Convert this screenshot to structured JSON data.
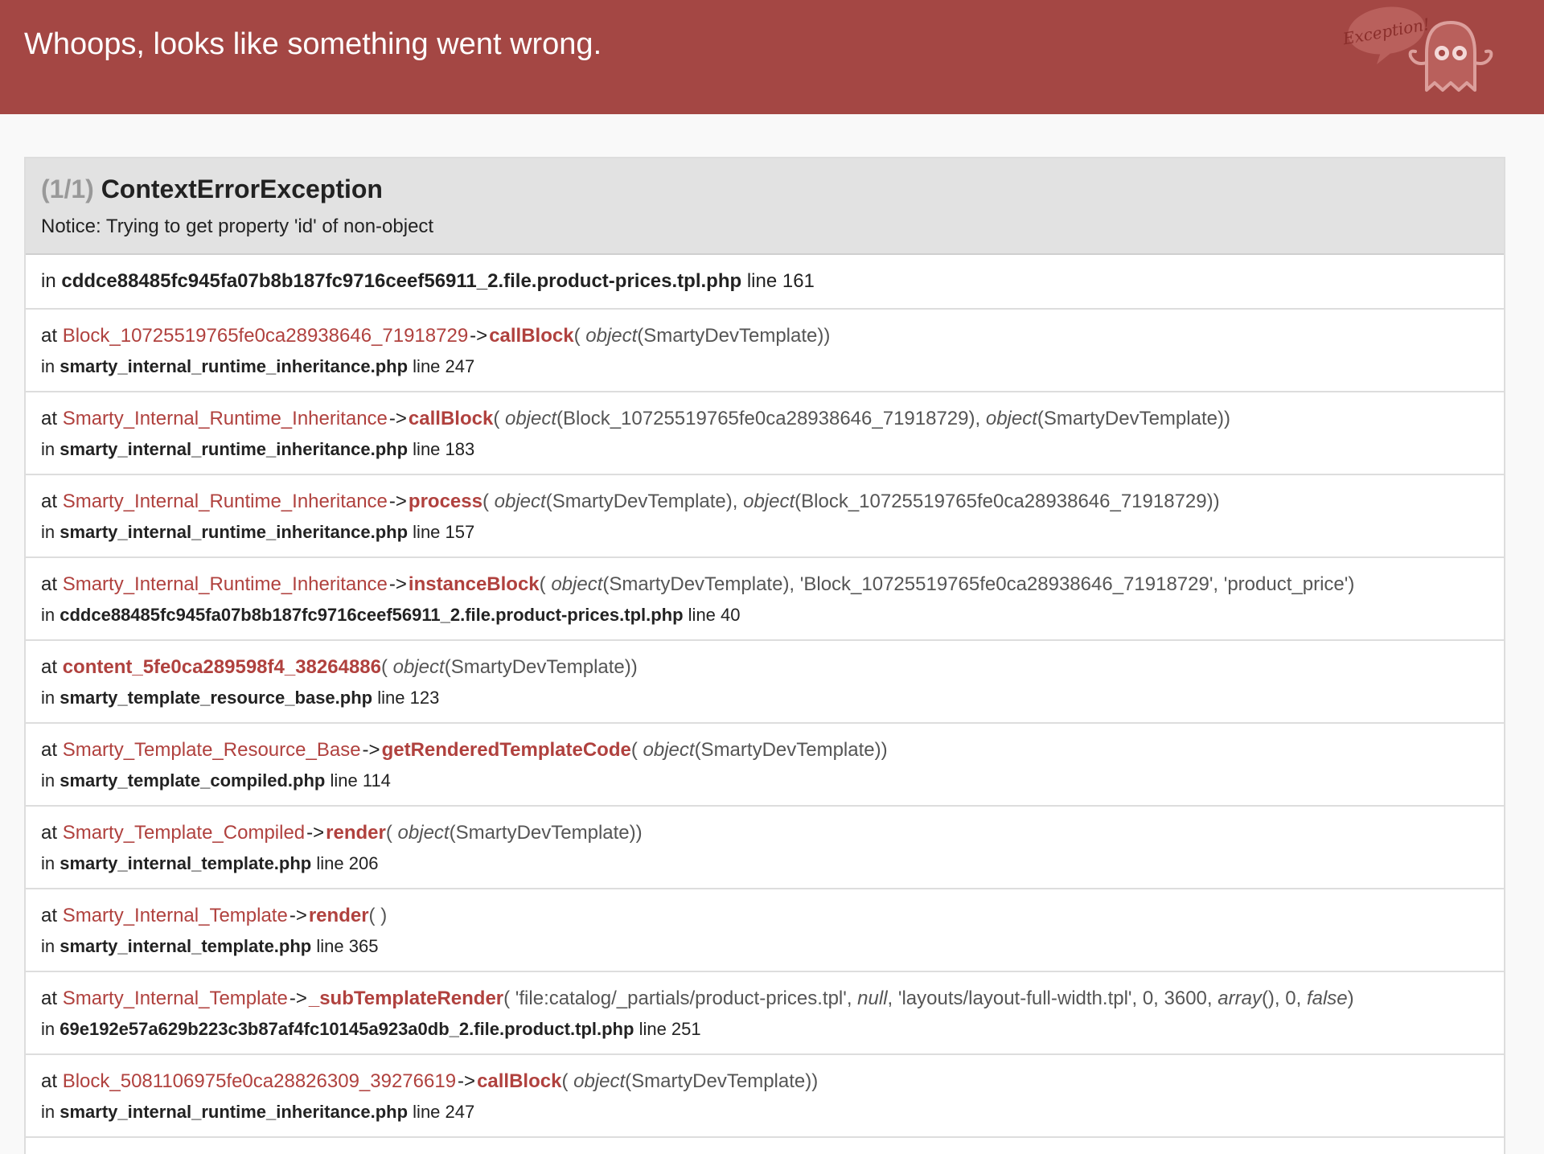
{
  "header": {
    "title": "Whoops, looks like something went wrong.",
    "logo_text": "Exception!",
    "bg_color": "#a44744"
  },
  "exception": {
    "count": "(1/1)",
    "class": "ContextErrorException",
    "message": "Notice: Trying to get property 'id' of non-object"
  },
  "origin": {
    "prefix": "in",
    "file": "cddce88485fc945fa07b8b187fc9716ceef56911_2.file.product-prices.tpl.php",
    "line_text": "line 161"
  },
  "frames": [
    {
      "at": "at",
      "class": "Block_10725519765fe0ca28938646_71918729",
      "arrow": "->",
      "func": "callBlock",
      "args": [
        {
          "t": "text",
          "v": "( "
        },
        {
          "t": "kw",
          "v": "object"
        },
        {
          "t": "text",
          "v": "(SmartyDevTemplate))"
        }
      ],
      "in": "in",
      "file": "smarty_internal_runtime_inheritance.php",
      "line_text": "line 247"
    },
    {
      "at": "at",
      "class": "Smarty_Internal_Runtime_Inheritance",
      "arrow": "->",
      "func": "callBlock",
      "args": [
        {
          "t": "text",
          "v": "( "
        },
        {
          "t": "kw",
          "v": "object"
        },
        {
          "t": "text",
          "v": "(Block_10725519765fe0ca28938646_71918729), "
        },
        {
          "t": "kw",
          "v": "object"
        },
        {
          "t": "text",
          "v": "(SmartyDevTemplate))"
        }
      ],
      "in": "in",
      "file": "smarty_internal_runtime_inheritance.php",
      "line_text": "line 183"
    },
    {
      "at": "at",
      "class": "Smarty_Internal_Runtime_Inheritance",
      "arrow": "->",
      "func": "process",
      "args": [
        {
          "t": "text",
          "v": "( "
        },
        {
          "t": "kw",
          "v": "object"
        },
        {
          "t": "text",
          "v": "(SmartyDevTemplate), "
        },
        {
          "t": "kw",
          "v": "object"
        },
        {
          "t": "text",
          "v": "(Block_10725519765fe0ca28938646_71918729))"
        }
      ],
      "in": "in",
      "file": "smarty_internal_runtime_inheritance.php",
      "line_text": "line 157"
    },
    {
      "at": "at",
      "class": "Smarty_Internal_Runtime_Inheritance",
      "arrow": "->",
      "func": "instanceBlock",
      "args": [
        {
          "t": "text",
          "v": "( "
        },
        {
          "t": "kw",
          "v": "object"
        },
        {
          "t": "text",
          "v": "(SmartyDevTemplate), 'Block_10725519765fe0ca28938646_71918729', 'product_price')"
        }
      ],
      "in": "in",
      "file": "cddce88485fc945fa07b8b187fc9716ceef56911_2.file.product-prices.tpl.php",
      "line_text": "line 40"
    },
    {
      "at": "at",
      "class": "",
      "arrow": "",
      "func": "content_5fe0ca289598f4_38264886",
      "args": [
        {
          "t": "text",
          "v": "( "
        },
        {
          "t": "kw",
          "v": "object"
        },
        {
          "t": "text",
          "v": "(SmartyDevTemplate))"
        }
      ],
      "in": "in",
      "file": "smarty_template_resource_base.php",
      "line_text": "line 123"
    },
    {
      "at": "at",
      "class": "Smarty_Template_Resource_Base",
      "arrow": "->",
      "func": "getRenderedTemplateCode",
      "args": [
        {
          "t": "text",
          "v": "( "
        },
        {
          "t": "kw",
          "v": "object"
        },
        {
          "t": "text",
          "v": "(SmartyDevTemplate))"
        }
      ],
      "in": "in",
      "file": "smarty_template_compiled.php",
      "line_text": "line 114"
    },
    {
      "at": "at",
      "class": "Smarty_Template_Compiled",
      "arrow": "->",
      "func": "render",
      "args": [
        {
          "t": "text",
          "v": "( "
        },
        {
          "t": "kw",
          "v": "object"
        },
        {
          "t": "text",
          "v": "(SmartyDevTemplate))"
        }
      ],
      "in": "in",
      "file": "smarty_internal_template.php",
      "line_text": "line 206"
    },
    {
      "at": "at",
      "class": "Smarty_Internal_Template",
      "arrow": "->",
      "func": "render",
      "args": [
        {
          "t": "text",
          "v": "( )"
        }
      ],
      "in": "in",
      "file": "smarty_internal_template.php",
      "line_text": "line 365"
    },
    {
      "at": "at",
      "class": "Smarty_Internal_Template",
      "arrow": "->",
      "func": "_subTemplateRender",
      "args": [
        {
          "t": "text",
          "v": "( 'file:catalog/_partials/product-prices.tpl', "
        },
        {
          "t": "kw",
          "v": "null"
        },
        {
          "t": "text",
          "v": ", 'layouts/layout-full-width.tpl', 0, 3600, "
        },
        {
          "t": "kw",
          "v": "array"
        },
        {
          "t": "text",
          "v": "(), 0, "
        },
        {
          "t": "kw",
          "v": "false"
        },
        {
          "t": "text",
          "v": ")"
        }
      ],
      "in": "in",
      "file": "69e192e57a629b223c3b87af4fc10145a923a0db_2.file.product.tpl.php",
      "line_text": "line 251"
    },
    {
      "at": "at",
      "class": "Block_5081106975fe0ca28826309_39276619",
      "arrow": "->",
      "func": "callBlock",
      "args": [
        {
          "t": "text",
          "v": "( "
        },
        {
          "t": "kw",
          "v": "object"
        },
        {
          "t": "text",
          "v": "(SmartyDevTemplate))"
        }
      ],
      "in": "in",
      "file": "smarty_internal_runtime_inheritance.php",
      "line_text": "line 247"
    }
  ]
}
